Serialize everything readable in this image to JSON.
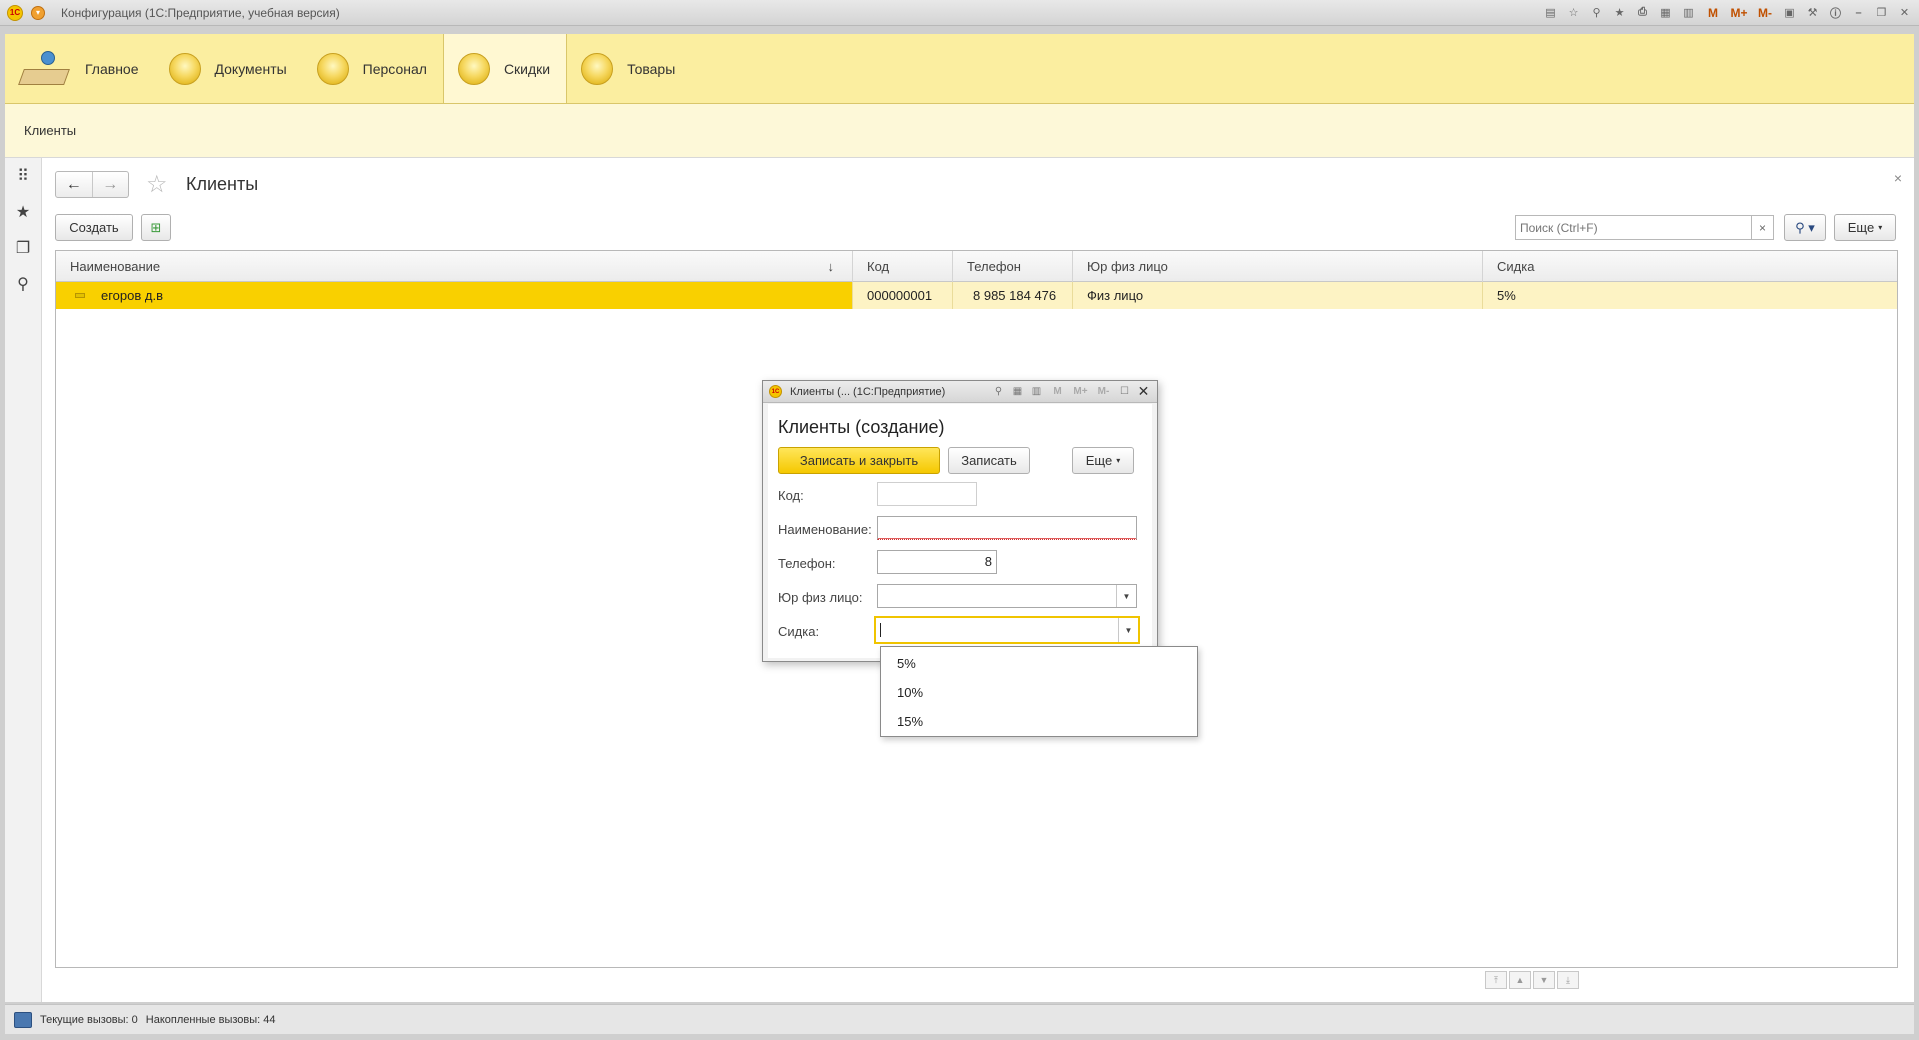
{
  "window": {
    "title": "Конфигурация  (1С:Предприятие, учебная версия)",
    "tools": {
      "m": "M",
      "mplus": "M+",
      "mminus": "M-"
    }
  },
  "sections": [
    {
      "label": "Главное"
    },
    {
      "label": "Документы"
    },
    {
      "label": "Персонал"
    },
    {
      "label": "Скидки"
    },
    {
      "label": "Товары"
    }
  ],
  "subpanel": {
    "item": "Клиенты"
  },
  "form": {
    "title": "Клиенты",
    "create_button": "Создать",
    "search_placeholder": "Поиск (Ctrl+F)",
    "more_button": "Еще"
  },
  "table": {
    "columns": [
      "Наименование",
      "Код",
      "Телефон",
      "Юр физ лицо",
      "Сидка"
    ],
    "rows": [
      {
        "name": "егоров д.в",
        "code": "000000001",
        "phone": "8 985 184 476",
        "type": "Физ лицо",
        "discount": "5%"
      }
    ]
  },
  "dialog": {
    "window_title": "Клиенты (...  (1С:Предприятие)",
    "tools": {
      "m": "M",
      "mplus": "M+",
      "mminus": "M-"
    },
    "heading": "Клиенты (создание)",
    "save_close_button": "Записать и закрыть",
    "save_button": "Записать",
    "more_button": "Еще",
    "fields": {
      "code_label": "Код:",
      "code_value": "",
      "name_label": "Наименование:",
      "name_value": "",
      "phone_label": "Телефон:",
      "phone_value": "8",
      "type_label": "Юр физ лицо:",
      "type_value": "",
      "discount_label": "Сидка:",
      "discount_value": ""
    }
  },
  "dropdown": {
    "options": [
      "5%",
      "10%",
      "15%"
    ]
  },
  "statusbar": {
    "current_calls": "Текущие вызовы: 0",
    "accumulated_calls": "Накопленные вызовы: 44"
  },
  "colors": {
    "sections_bg": "#fbeea0",
    "row_selected": "#f9d000",
    "row_bg": "#fdf3c4",
    "primary_button": "#f5c800"
  }
}
